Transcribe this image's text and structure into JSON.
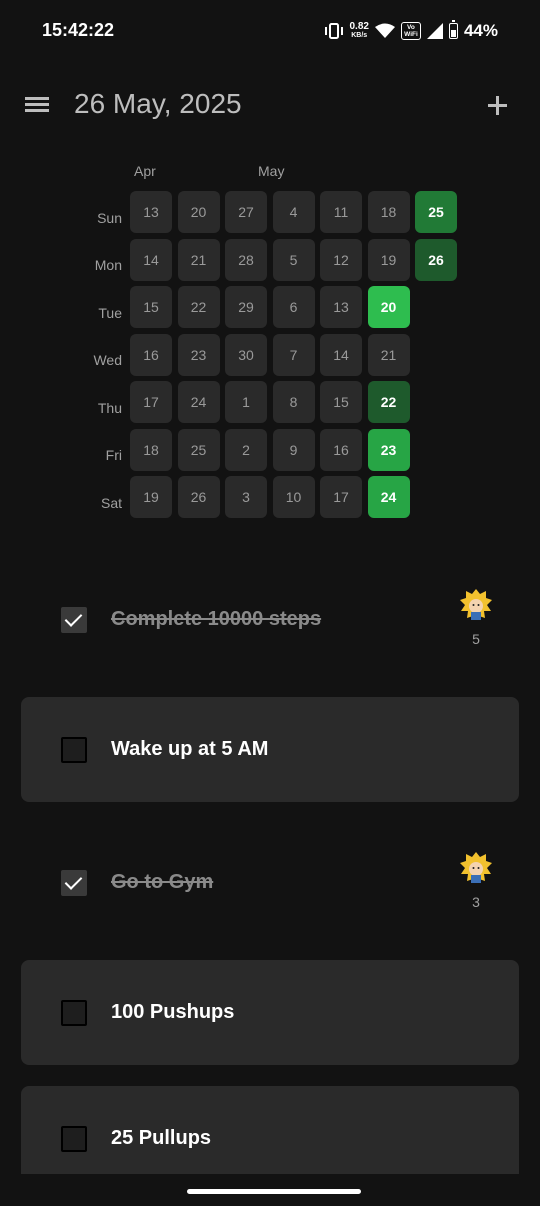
{
  "status_bar": {
    "time": "15:42:22",
    "speed_top": "0.82",
    "speed_unit": "KB/s",
    "vowifi_top": "Vo",
    "vowifi_bot": "WiFi",
    "battery": "44%"
  },
  "header": {
    "title": "26 May, 2025",
    "menu_icon": "hamburger-menu-icon",
    "add_icon": "plus-icon"
  },
  "heatmap": {
    "months": [
      "Apr",
      "May"
    ],
    "weekdays": [
      "Sun",
      "Mon",
      "Tue",
      "Wed",
      "Thu",
      "Fri",
      "Sat"
    ],
    "weeks": [
      [
        "13",
        "14",
        "15",
        "16",
        "17",
        "18",
        "19"
      ],
      [
        "20",
        "21",
        "22",
        "23",
        "24",
        "25",
        "26"
      ],
      [
        "27",
        "28",
        "29",
        "30",
        "1",
        "2",
        "3"
      ],
      [
        "4",
        "5",
        "6",
        "7",
        "8",
        "9",
        "10"
      ],
      [
        "11",
        "12",
        "13",
        "14",
        "15",
        "16",
        "17"
      ],
      [
        "18",
        "19",
        "20",
        "21",
        "22",
        "23",
        "24"
      ],
      [
        "25",
        "26",
        "",
        "",
        "",
        "",
        ""
      ]
    ],
    "done_colors": {
      "5-2": "#2ebd4f",
      "5-4": "#1e5a2c",
      "5-5": "#27a545",
      "5-6": "#27a545",
      "6-0": "#217a36",
      "6-1": "#1e5a2c"
    },
    "empty_color": "#2a2a2a"
  },
  "tasks": [
    {
      "label": "Complete 10000 steps",
      "checked": true,
      "streak": "5"
    },
    {
      "label": "Wake up at 5 AM",
      "checked": false
    },
    {
      "label": "Go to Gym",
      "checked": true,
      "streak": "3"
    },
    {
      "label": "100 Pushups",
      "checked": false
    },
    {
      "label": "25 Pullups",
      "checked": false
    }
  ]
}
